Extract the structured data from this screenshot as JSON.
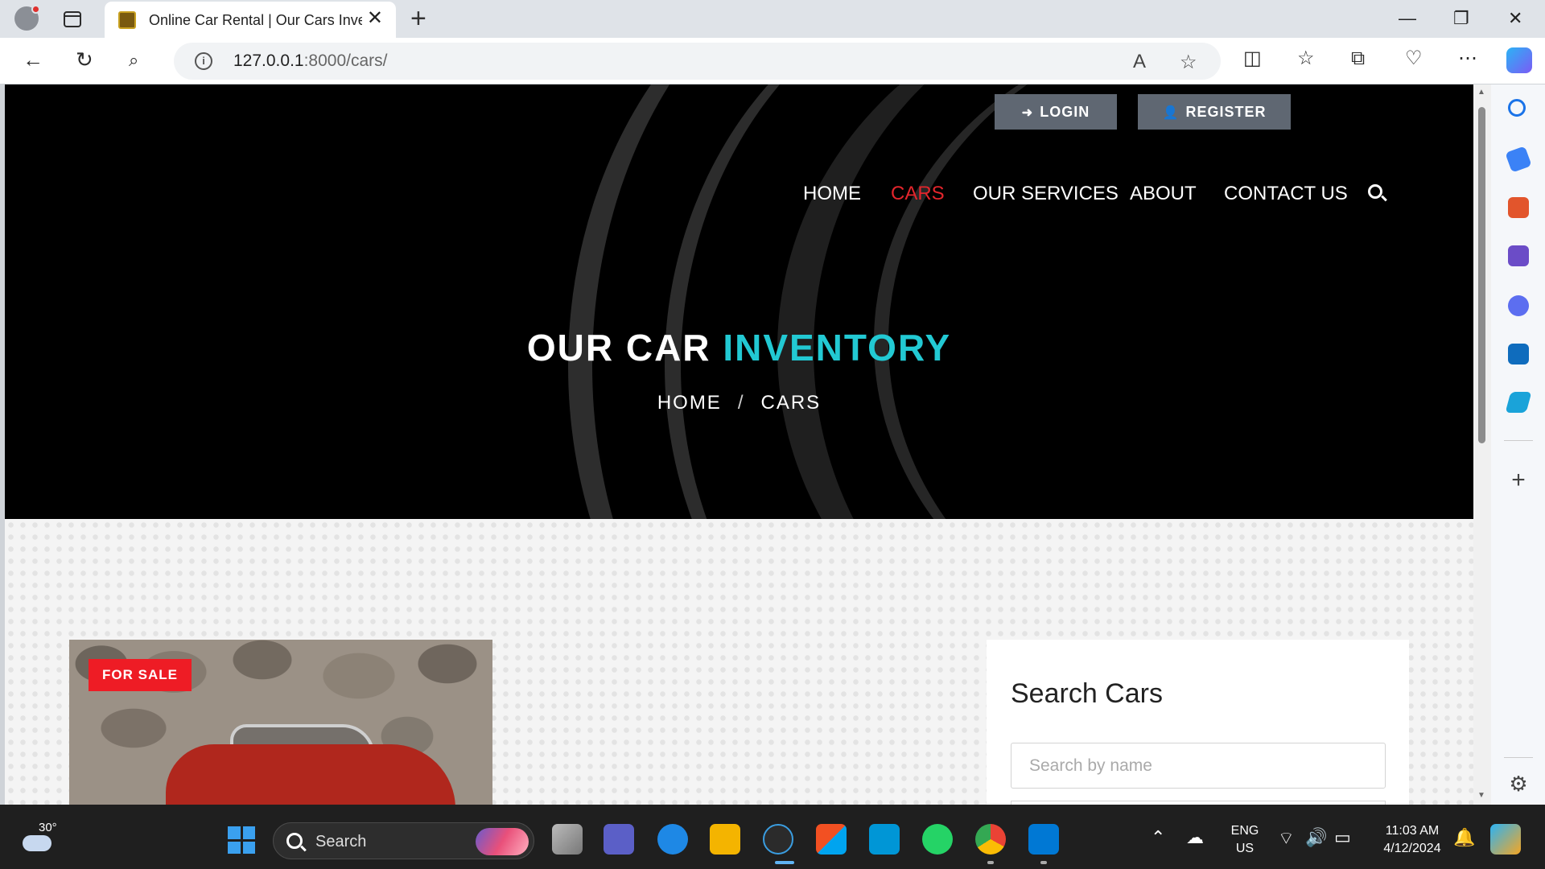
{
  "browser": {
    "tab_title": "Online Car Rental | Our Cars Inventory",
    "url_host": "127.0.0.1",
    "url_rest": ":8000/cars/"
  },
  "header": {
    "login_label": "LOGIN",
    "register_label": "REGISTER",
    "nav": [
      {
        "label": "HOME"
      },
      {
        "label": "CARS"
      },
      {
        "label": "OUR SERVICES"
      },
      {
        "label": "ABOUT"
      },
      {
        "label": "CONTACT US"
      }
    ],
    "active_nav": "CARS"
  },
  "hero": {
    "title_main": "OUR CAR",
    "title_accent": "INVENTORY",
    "breadcrumb": [
      "HOME",
      "CARS"
    ],
    "breadcrumb_sep": "/"
  },
  "listing": {
    "badge": "FOR SALE"
  },
  "search_panel": {
    "title": "Search Cars",
    "placeholder": "Search by name"
  },
  "taskbar": {
    "temperature": "30°",
    "search_label": "Search",
    "lang_top": "ENG",
    "lang_bottom": "US",
    "time": "11:03 AM",
    "date": "4/12/2024"
  },
  "colors": {
    "accent_red": "#e3252c",
    "accent_cyan": "#22c9d3",
    "badge_red": "#ee1c25"
  }
}
